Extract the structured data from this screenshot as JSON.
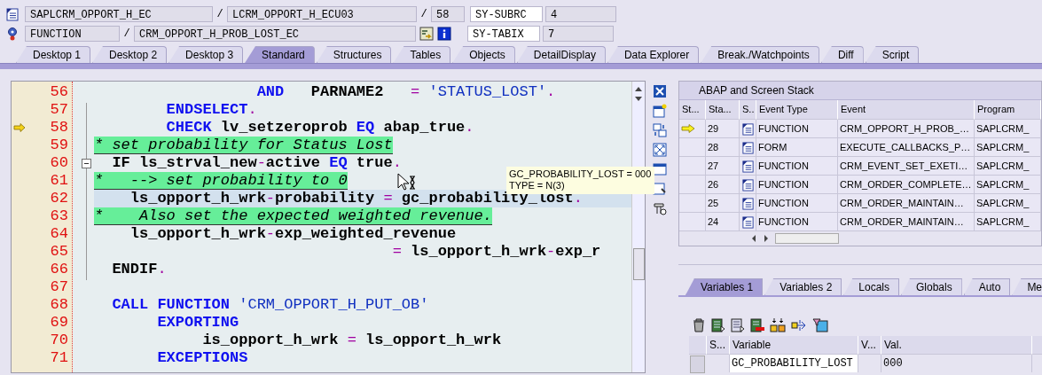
{
  "header": {
    "row_1": {
      "program": "SAPLCRM_OPPORT_H_EC",
      "separator_1": "/",
      "include": "LCRM_OPPORT_H_ECU03",
      "separator_2": "/",
      "line": "58",
      "sy_field": "SY-SUBRC",
      "sy_value": "4"
    },
    "row_2": {
      "event_type": "FUNCTION",
      "separator": "/",
      "event": "CRM_OPPORT_H_PROB_LOST_EC",
      "sy_field": "SY-TABIX",
      "sy_value": "7"
    }
  },
  "tabs": [
    {
      "label": "Desktop 1",
      "selected": false
    },
    {
      "label": "Desktop 2",
      "selected": false
    },
    {
      "label": "Desktop 3",
      "selected": false
    },
    {
      "label": "Standard",
      "selected": true
    },
    {
      "label": "Structures",
      "selected": false
    },
    {
      "label": "Tables",
      "selected": false
    },
    {
      "label": "Objects",
      "selected": false
    },
    {
      "label": "DetailDisplay",
      "selected": false
    },
    {
      "label": "Data Explorer",
      "selected": false
    },
    {
      "label": "Break./Watchpoints",
      "selected": false
    },
    {
      "label": "Diff",
      "selected": false
    },
    {
      "label": "Script",
      "selected": false
    }
  ],
  "editor": {
    "lines": [
      {
        "number": "56",
        "current": false,
        "highlighted": false,
        "foldable": false,
        "tokens": [
          {
            "kind": "kw",
            "text": "                  AND"
          },
          {
            "kind": "id",
            "text": "   PARNAME2   "
          },
          {
            "kind": "op",
            "text": "="
          },
          {
            "kind": "str",
            "text": " 'STATUS_LOST'"
          },
          {
            "kind": "op",
            "text": "."
          }
        ]
      },
      {
        "number": "57",
        "current": false,
        "highlighted": false,
        "foldable": false,
        "tokens": [
          {
            "kind": "kw",
            "text": "        ENDSELECT"
          },
          {
            "kind": "op",
            "text": "."
          }
        ]
      },
      {
        "number": "58",
        "current": true,
        "highlighted": false,
        "foldable": false,
        "tokens": [
          {
            "kind": "kw",
            "text": "        CHECK"
          },
          {
            "kind": "id",
            "text": " lv_setzeroprob "
          },
          {
            "kind": "kw",
            "text": "EQ"
          },
          {
            "kind": "id",
            "text": " abap_true"
          },
          {
            "kind": "op",
            "text": "."
          }
        ]
      },
      {
        "number": "59",
        "current": false,
        "highlighted": false,
        "foldable": false,
        "tokens": [
          {
            "kind": "comment",
            "text": "* set probability for Status Lost"
          }
        ]
      },
      {
        "number": "60",
        "current": false,
        "highlighted": false,
        "foldable": true,
        "tokens": [
          {
            "kind": "id",
            "text": "  IF ls_strval_new"
          },
          {
            "kind": "op",
            "text": "-"
          },
          {
            "kind": "id",
            "text": "active "
          },
          {
            "kind": "kw",
            "text": "EQ"
          },
          {
            "kind": "id",
            "text": " true"
          },
          {
            "kind": "op",
            "text": "."
          }
        ]
      },
      {
        "number": "61",
        "current": false,
        "highlighted": false,
        "foldable": false,
        "tokens": [
          {
            "kind": "comment",
            "text": "*   --> set probability to 0"
          }
        ]
      },
      {
        "number": "62",
        "current": false,
        "highlighted": true,
        "foldable": false,
        "tokens": [
          {
            "kind": "id",
            "text": "    ls_opport_h_wrk"
          },
          {
            "kind": "op",
            "text": "-"
          },
          {
            "kind": "id",
            "text": "probability "
          },
          {
            "kind": "op",
            "text": "="
          },
          {
            "kind": "id",
            "text": " gc_probability_lost"
          },
          {
            "kind": "op",
            "text": "."
          }
        ]
      },
      {
        "number": "63",
        "current": false,
        "highlighted": false,
        "foldable": false,
        "tokens": [
          {
            "kind": "comment",
            "text": "*    Also set the expected weighted revenue."
          }
        ]
      },
      {
        "number": "64",
        "current": false,
        "highlighted": false,
        "foldable": false,
        "tokens": [
          {
            "kind": "id",
            "text": "    ls_opport_h_wrk"
          },
          {
            "kind": "op",
            "text": "-"
          },
          {
            "kind": "id",
            "text": "exp_weighted_revenue"
          }
        ]
      },
      {
        "number": "65",
        "current": false,
        "highlighted": false,
        "foldable": false,
        "tokens": [
          {
            "kind": "op",
            "text": "                                 ="
          },
          {
            "kind": "id",
            "text": " ls_opport_h_wrk"
          },
          {
            "kind": "op",
            "text": "-"
          },
          {
            "kind": "id",
            "text": "exp_r"
          }
        ]
      },
      {
        "number": "66",
        "current": false,
        "highlighted": false,
        "foldable": false,
        "tokens": [
          {
            "kind": "id",
            "text": "  ENDIF"
          },
          {
            "kind": "op",
            "text": "."
          }
        ]
      },
      {
        "number": "67",
        "current": false,
        "highlighted": false,
        "foldable": false
      },
      {
        "number": "68",
        "current": false,
        "highlighted": false,
        "foldable": false,
        "tokens": [
          {
            "kind": "kw",
            "text": "  CALL FUNCTION"
          },
          {
            "kind": "str",
            "text": " 'CRM_OPPORT_H_PUT_OB'"
          }
        ]
      },
      {
        "number": "69",
        "current": false,
        "highlighted": false,
        "foldable": false,
        "tokens": [
          {
            "kind": "kw",
            "text": "       EXPORTING"
          }
        ]
      },
      {
        "number": "70",
        "current": false,
        "highlighted": false,
        "foldable": false,
        "tokens": [
          {
            "kind": "id",
            "text": "            is_opport_h_wrk "
          },
          {
            "kind": "op",
            "text": "="
          },
          {
            "kind": "id",
            "text": " ls_opport_h_wrk"
          }
        ]
      },
      {
        "number": "71",
        "current": false,
        "highlighted": false,
        "foldable": false,
        "tokens": [
          {
            "kind": "kw",
            "text": "       EXCEPTIONS"
          }
        ]
      }
    ],
    "tooltip": [
      "GC_PROBABILITY_LOST = 000",
      "TYPE  = N(3)"
    ]
  },
  "stack": {
    "title": "ABAP and Screen Stack",
    "columns": [
      "St...",
      "Sta...",
      "S..",
      "Event Type",
      "Event",
      "Program"
    ],
    "rows": [
      {
        "current": true,
        "level": "29",
        "event_type": "FUNCTION",
        "event": "CRM_OPPORT_H_PROB_…",
        "program": "SAPLCRM_"
      },
      {
        "current": false,
        "level": "28",
        "event_type": "FORM",
        "event": "EXECUTE_CALLBACKS_P…",
        "program": "SAPLCRM_"
      },
      {
        "current": false,
        "level": "27",
        "event_type": "FUNCTION",
        "event": "CRM_EVENT_SET_EXETI…",
        "program": "SAPLCRM_"
      },
      {
        "current": false,
        "level": "26",
        "event_type": "FUNCTION",
        "event": "CRM_ORDER_COMPLETE…",
        "program": "SAPLCRM_"
      },
      {
        "current": false,
        "level": "25",
        "event_type": "FUNCTION",
        "event": "CRM_ORDER_MAINTAIN…",
        "program": "SAPLCRM_"
      },
      {
        "current": false,
        "level": "24",
        "event_type": "FUNCTION",
        "event": "CRM_ORDER_MAINTAIN…",
        "program": "SAPLCRM_"
      }
    ]
  },
  "variables": {
    "tabs": [
      {
        "label": "Variables 1",
        "selected": true
      },
      {
        "label": "Variables 2",
        "selected": false
      },
      {
        "label": "Locals",
        "selected": false
      },
      {
        "label": "Globals",
        "selected": false
      },
      {
        "label": "Auto",
        "selected": false
      },
      {
        "label": "Me",
        "selected": false
      }
    ],
    "columns": [
      "S...",
      "Variable",
      "V...",
      "Val."
    ],
    "rows": [
      {
        "variable": "GC_PROBABILITY_LOST",
        "value": "000"
      }
    ]
  }
}
